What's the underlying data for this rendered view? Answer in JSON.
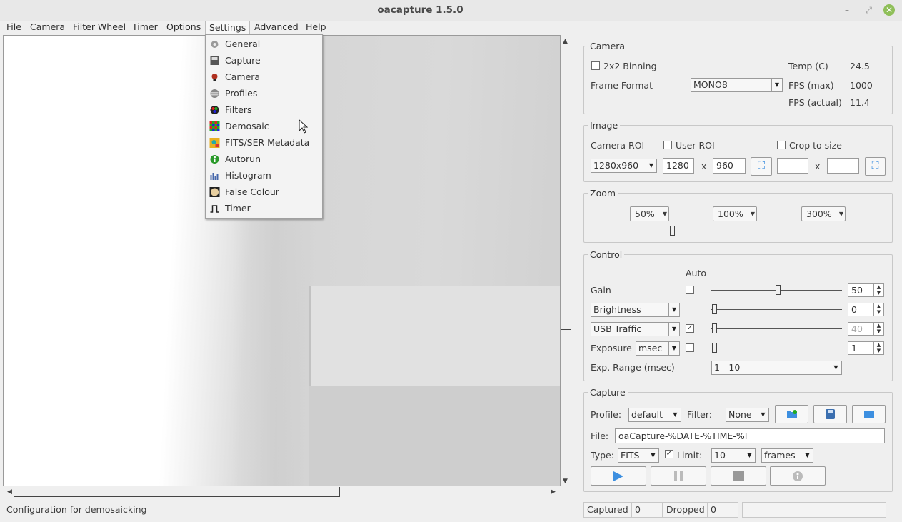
{
  "window": {
    "title": "oacapture 1.5.0",
    "minimize": "–",
    "maximize": "⤢",
    "close": "✕"
  },
  "menu": [
    "File",
    "Camera",
    "Filter Wheel",
    "Timer",
    "Options",
    "Settings",
    "Advanced",
    "Help"
  ],
  "settings_menu": [
    "General",
    "Capture",
    "Camera",
    "Profiles",
    "Filters",
    "Demosaic",
    "FITS/SER Metadata",
    "Autorun",
    "Histogram",
    "False Colour",
    "Timer"
  ],
  "status": "Configuration for demosaicking",
  "camera": {
    "group": "Camera",
    "binning_label": "2x2 Binning",
    "frame_format_label": "Frame Format",
    "frame_format": "MONO8",
    "temp_label": "Temp (C)",
    "temp": "24.5",
    "fps_max_label": "FPS (max)",
    "fps_max": "1000",
    "fps_actual_label": "FPS (actual)",
    "fps_actual": "11.4"
  },
  "image": {
    "group": "Image",
    "roi_label": "Camera ROI",
    "user_roi_label": "User ROI",
    "crop_label": "Crop to size",
    "roi": "1280x960",
    "width": "1280",
    "height": "960",
    "x": "x"
  },
  "zoom": {
    "group": "Zoom",
    "z50": "50%",
    "z100": "100%",
    "z300": "300%",
    "level": 0.1
  },
  "control": {
    "group": "Control",
    "auto_label": "Auto",
    "gain_label": "Gain",
    "gain": "50",
    "brightness": "Brightness",
    "brightness_value": "0",
    "usb": "USB Traffic",
    "usb_value": "40",
    "exposure_label": "Exposure",
    "exposure_unit": "msec",
    "exposure_value": "1",
    "exp_range_label": "Exp. Range (msec)",
    "exp_range": "1 - 10"
  },
  "capture": {
    "group": "Capture",
    "profile_label": "Profile:",
    "profile": "default",
    "filter_label": "Filter:",
    "filter": "None",
    "file_label": "File:",
    "file": "oaCapture-%DATE-%TIME-%I",
    "type_label": "Type:",
    "type": "FITS",
    "limit_label": "Limit:",
    "limit": "10",
    "limit_unit": "frames",
    "captured_label": "Captured",
    "captured": "0",
    "dropped_label": "Dropped",
    "dropped": "0"
  },
  "colors": {
    "accent": "#3d8fe0",
    "close": "#8fbf59"
  }
}
